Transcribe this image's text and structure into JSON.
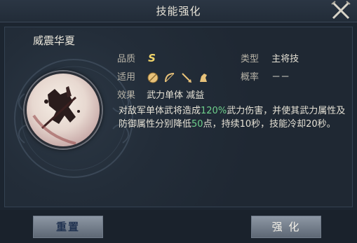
{
  "header": {
    "title": "技能强化"
  },
  "skill": {
    "name": "威震华夏",
    "quality_label": "品质",
    "quality": "S",
    "type_label": "类型",
    "type": "主将技",
    "suit_label": "适用",
    "weapons": [
      "shield-icon",
      "bow-icon",
      "spear-icon",
      "cavalry-icon"
    ],
    "rate_label": "概率",
    "rate": "－－",
    "effect_label": "效果",
    "effect_tags": "武力单体 减益",
    "desc_part1": "对敌军单体武将造成",
    "desc_pct": "120%",
    "desc_part2": "武力伤害，并使其武力属性及防御属性分别降低",
    "desc_num": "50",
    "desc_part3": "点，持续10秒，技能冷却20秒。"
  },
  "buttons": {
    "reset": "重置",
    "enhance": "强 化"
  },
  "colors": {
    "quality": "#f3d66a",
    "highlight": "#6fd08c"
  }
}
